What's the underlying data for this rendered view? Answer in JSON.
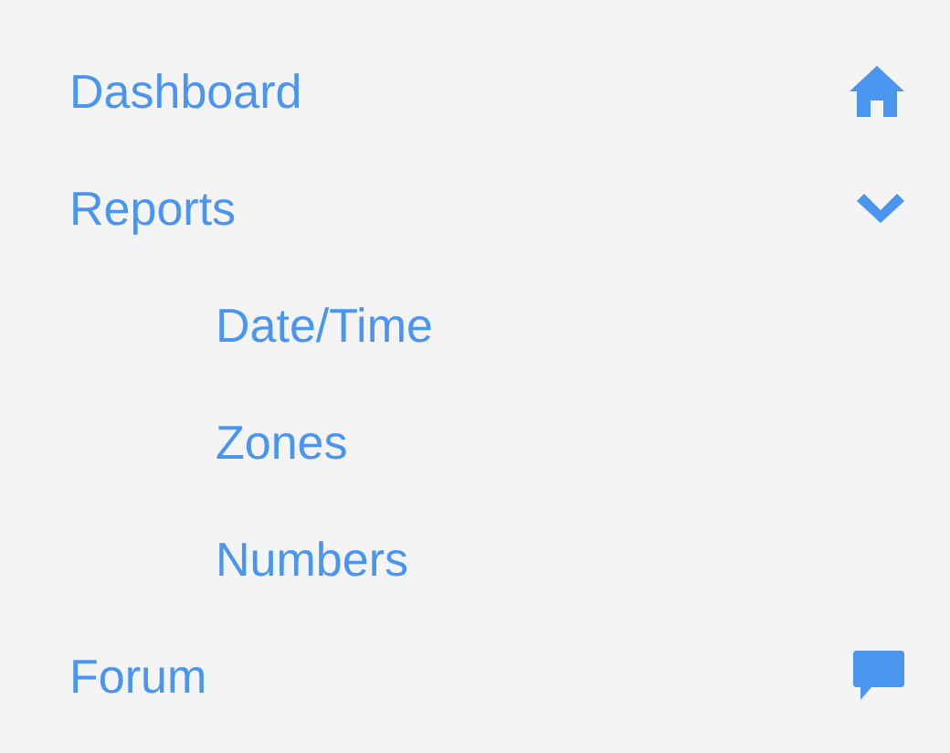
{
  "menu": {
    "items": [
      {
        "label": "Dashboard",
        "kind": "home"
      },
      {
        "label": "Reports",
        "kind": "group",
        "expanded": true,
        "children": [
          {
            "label": "Date/Time"
          },
          {
            "label": "Zones"
          },
          {
            "label": "Numbers"
          }
        ]
      },
      {
        "label": "Forum",
        "kind": "chat"
      }
    ]
  }
}
